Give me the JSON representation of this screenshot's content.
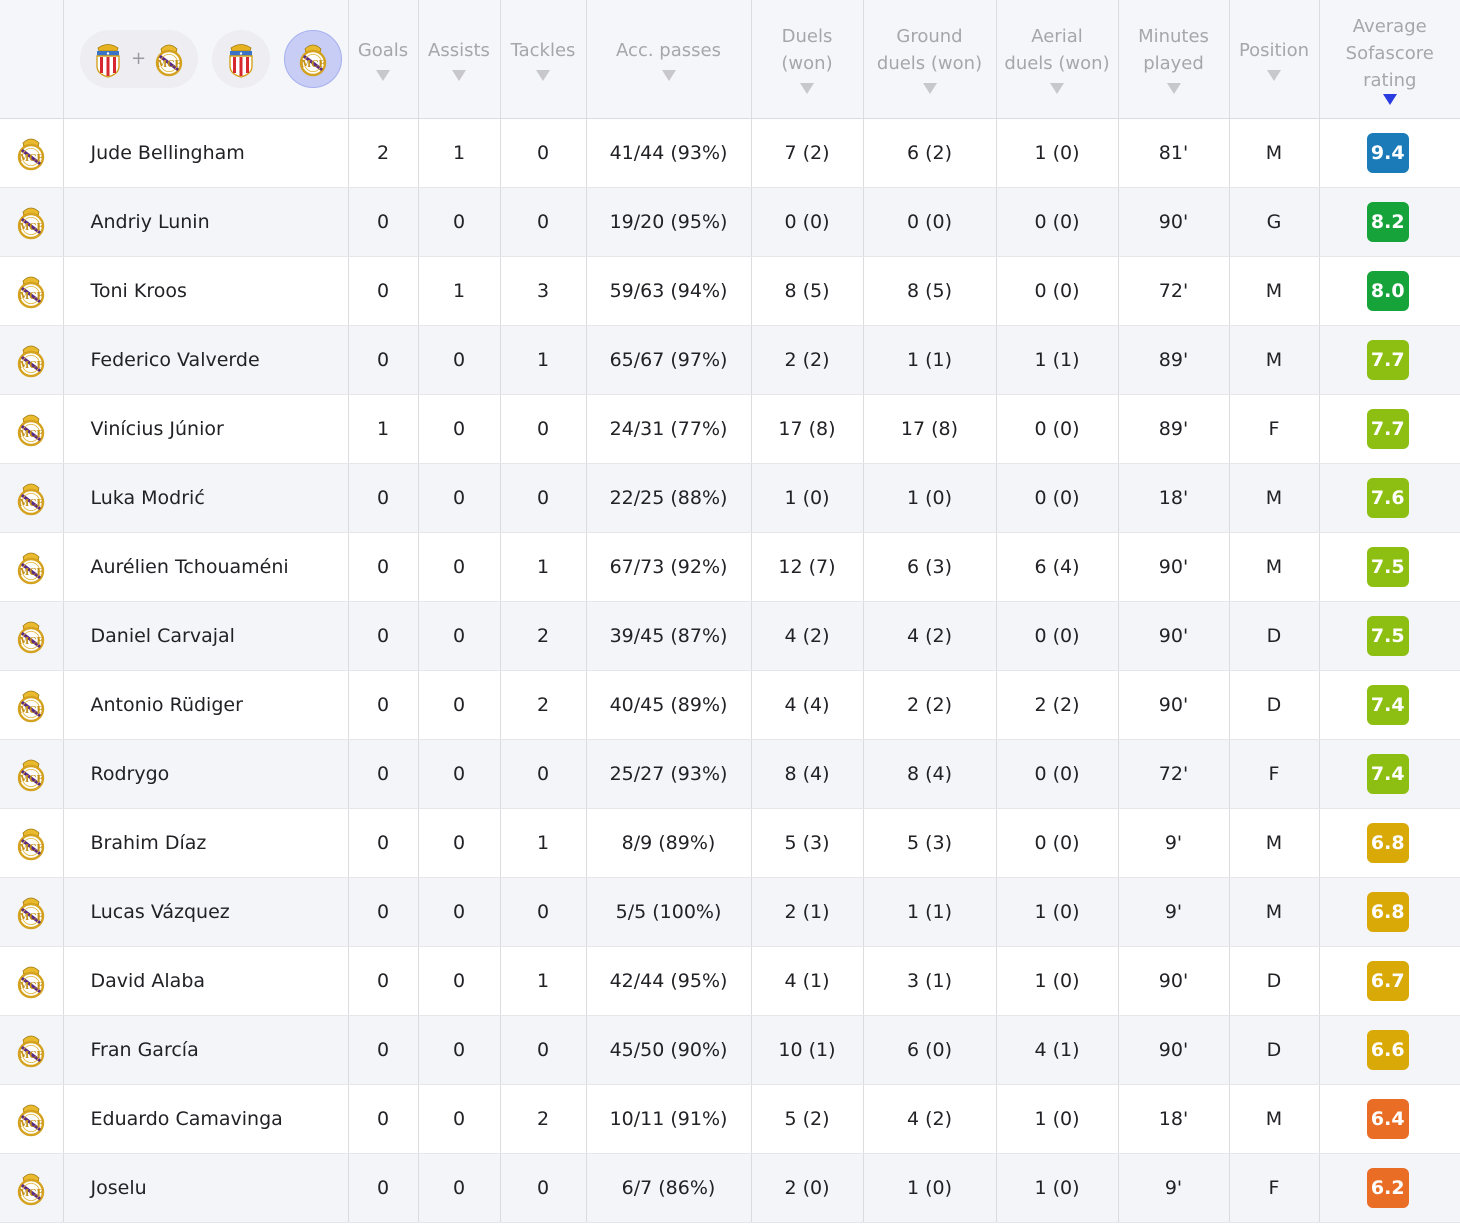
{
  "header": {
    "filters": [
      {
        "name": "both-teams",
        "label": "+"
      },
      {
        "name": "almeria"
      },
      {
        "name": "real-madrid",
        "selected": true
      }
    ],
    "columns": {
      "goals": "Goals",
      "assists": "Assists",
      "tackles": "Tackles",
      "acc_passes": "Acc. passes",
      "duels": [
        "Duels",
        "(won)"
      ],
      "ground": [
        "Ground",
        "duels (won)"
      ],
      "aerial": [
        "Aerial",
        "duels (won)"
      ],
      "minutes": [
        "Minutes",
        "played"
      ],
      "position": "Position",
      "rating": [
        "Average",
        "Sofascore",
        "rating"
      ]
    },
    "sort_column": "rating"
  },
  "rating_colors": {
    "9.4": "#1a7bb8",
    "8.2": "#16a33a",
    "8.0": "#16a33a",
    "7.7": "#8cbf12",
    "7.6": "#8cbf12",
    "7.5": "#8cbf12",
    "7.4": "#8cbf12",
    "6.8": "#d9a908",
    "6.7": "#d9a908",
    "6.6": "#d9a908",
    "6.4": "#ea6d26",
    "6.2": "#ea6d26"
  },
  "rows": [
    {
      "player": "Jude Bellingham",
      "goals": "2",
      "assists": "1",
      "tackles": "0",
      "acc_passes": "41/44 (93%)",
      "duels": "7 (2)",
      "ground": "6 (2)",
      "aerial": "1 (0)",
      "minutes": "81'",
      "position": "M",
      "rating": "9.4"
    },
    {
      "player": "Andriy Lunin",
      "goals": "0",
      "assists": "0",
      "tackles": "0",
      "acc_passes": "19/20 (95%)",
      "duels": "0 (0)",
      "ground": "0 (0)",
      "aerial": "0 (0)",
      "minutes": "90'",
      "position": "G",
      "rating": "8.2"
    },
    {
      "player": "Toni Kroos",
      "goals": "0",
      "assists": "1",
      "tackles": "3",
      "acc_passes": "59/63 (94%)",
      "duels": "8 (5)",
      "ground": "8 (5)",
      "aerial": "0 (0)",
      "minutes": "72'",
      "position": "M",
      "rating": "8.0"
    },
    {
      "player": "Federico Valverde",
      "goals": "0",
      "assists": "0",
      "tackles": "1",
      "acc_passes": "65/67 (97%)",
      "duels": "2 (2)",
      "ground": "1 (1)",
      "aerial": "1 (1)",
      "minutes": "89'",
      "position": "M",
      "rating": "7.7"
    },
    {
      "player": "Vinícius Júnior",
      "goals": "1",
      "assists": "0",
      "tackles": "0",
      "acc_passes": "24/31 (77%)",
      "duels": "17 (8)",
      "ground": "17 (8)",
      "aerial": "0 (0)",
      "minutes": "89'",
      "position": "F",
      "rating": "7.7"
    },
    {
      "player": "Luka Modrić",
      "goals": "0",
      "assists": "0",
      "tackles": "0",
      "acc_passes": "22/25 (88%)",
      "duels": "1 (0)",
      "ground": "1 (0)",
      "aerial": "0 (0)",
      "minutes": "18'",
      "position": "M",
      "rating": "7.6"
    },
    {
      "player": "Aurélien Tchouaméni",
      "goals": "0",
      "assists": "0",
      "tackles": "1",
      "acc_passes": "67/73 (92%)",
      "duels": "12 (7)",
      "ground": "6 (3)",
      "aerial": "6 (4)",
      "minutes": "90'",
      "position": "M",
      "rating": "7.5"
    },
    {
      "player": "Daniel Carvajal",
      "goals": "0",
      "assists": "0",
      "tackles": "2",
      "acc_passes": "39/45 (87%)",
      "duels": "4 (2)",
      "ground": "4 (2)",
      "aerial": "0 (0)",
      "minutes": "90'",
      "position": "D",
      "rating": "7.5"
    },
    {
      "player": "Antonio Rüdiger",
      "goals": "0",
      "assists": "0",
      "tackles": "2",
      "acc_passes": "40/45 (89%)",
      "duels": "4 (4)",
      "ground": "2 (2)",
      "aerial": "2 (2)",
      "minutes": "90'",
      "position": "D",
      "rating": "7.4"
    },
    {
      "player": "Rodrygo",
      "goals": "0",
      "assists": "0",
      "tackles": "0",
      "acc_passes": "25/27 (93%)",
      "duels": "8 (4)",
      "ground": "8 (4)",
      "aerial": "0 (0)",
      "minutes": "72'",
      "position": "F",
      "rating": "7.4"
    },
    {
      "player": "Brahim Díaz",
      "goals": "0",
      "assists": "0",
      "tackles": "1",
      "acc_passes": "8/9 (89%)",
      "duels": "5 (3)",
      "ground": "5 (3)",
      "aerial": "0 (0)",
      "minutes": "9'",
      "position": "M",
      "rating": "6.8"
    },
    {
      "player": "Lucas Vázquez",
      "goals": "0",
      "assists": "0",
      "tackles": "0",
      "acc_passes": "5/5 (100%)",
      "duels": "2 (1)",
      "ground": "1 (1)",
      "aerial": "1 (0)",
      "minutes": "9'",
      "position": "M",
      "rating": "6.8"
    },
    {
      "player": "David Alaba",
      "goals": "0",
      "assists": "0",
      "tackles": "1",
      "acc_passes": "42/44 (95%)",
      "duels": "4 (1)",
      "ground": "3 (1)",
      "aerial": "1 (0)",
      "minutes": "90'",
      "position": "D",
      "rating": "6.7"
    },
    {
      "player": "Fran García",
      "goals": "0",
      "assists": "0",
      "tackles": "0",
      "acc_passes": "45/50 (90%)",
      "duels": "10 (1)",
      "ground": "6 (0)",
      "aerial": "4 (1)",
      "minutes": "90'",
      "position": "D",
      "rating": "6.6"
    },
    {
      "player": "Eduardo Camavinga",
      "goals": "0",
      "assists": "0",
      "tackles": "2",
      "acc_passes": "10/11 (91%)",
      "duels": "5 (2)",
      "ground": "4 (2)",
      "aerial": "1 (0)",
      "minutes": "18'",
      "position": "M",
      "rating": "6.4"
    },
    {
      "player": "Joselu",
      "goals": "0",
      "assists": "0",
      "tackles": "0",
      "acc_passes": "6/7 (86%)",
      "duels": "2 (0)",
      "ground": "1 (0)",
      "aerial": "1 (0)",
      "minutes": "9'",
      "position": "F",
      "rating": "6.2"
    }
  ]
}
